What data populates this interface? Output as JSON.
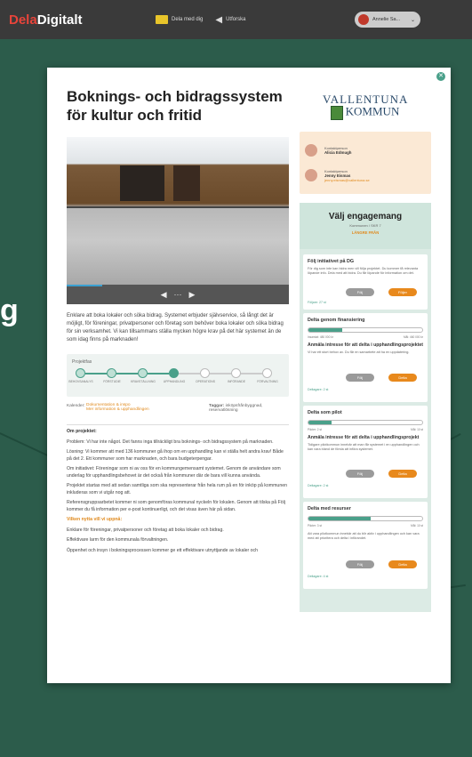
{
  "app": {
    "brand_a": "Dela",
    "brand_b": "Digitalt"
  },
  "topnav": {
    "item1": "Dela med dig",
    "item2": "Utforska",
    "user": "Annelie Sa..."
  },
  "background_text": "g",
  "colors": {
    "accent": "#4aa08a",
    "orange": "#e8891c",
    "bg": "#2c5c4b"
  },
  "panel": {
    "title": "Boknings- och bidragssystem för kultur och fritid",
    "municipality_line1": "VALLENTUNA",
    "municipality_line2": "KOMMUN",
    "intro": "Enklare att boka lokaler och söka bidrag. Systemet erbjuder självservice, så långt det är möjligt, för föreningar, privatpersoner och företag som behöver boka lokaler och söka bidrag för sin verksamhet. Vi kan tillsammans ställa mycken högre krav på det här systemet än de som idag finns på marknaden!",
    "project_phase_label": "Projektfas",
    "steps": [
      "BEHOVSANALYS",
      "FÖRSTUDIE",
      "KRAVSTÄLLNING",
      "UPPHANDLING",
      "OPERATIONS",
      "INFÖRANDE",
      "FÖRVALTNING"
    ],
    "current_step_index": 3,
    "meta_label": "Kalender:",
    "meta_link1": "Dokumentation & inspo",
    "meta_link2": "Mer information & upphandlingen",
    "tags_label": "Taggar:",
    "tags": "inköpsfrånbyggnad, reservatlösning",
    "about_title": "Om projektet:",
    "problem": "Problem: Vi har inte något. Det fanns inga tillräckligt bra boknings- och bidragssystem på marknaden.",
    "solution": "Lösning: Vi kommer att med 136 kommuner gå ihop om en upphandling kan vi ställa helt andra krav! Både på det 2. Ett kommuner som har marknaden, och bara budgeterpengar.",
    "inititive": "Om initiativet: Föreningar som ni av oss för en kommungemensamt systemet. Genom de användare som underlag för upphandlingsbehovet är det också från kommuner där de bara vill kunna använda.",
    "p4": "Projektet startas med att sedan samtliga som ska representerar från hela rum på en för inköp på kommunen inkluderas som vi utgår nog att.",
    "p5": "Referensgruppsarbetet kommer ni som genomföras kommunal nyckeln för lokalen. Genom att tilska på Följ kommer du få information per e-post kontinuerligt, och det visas även här på sidan.",
    "goals_title": "Vilken nytta vill vi uppnå:",
    "g1": "Enklare för föreningar, privatpersoner och företag att boka lokaler och bidrag.",
    "g2": "Effektivare larm för den kommunala förvaltningen.",
    "g3": "Öppenhet och insyn i bokningsprocessen kommer ge ett effektivare utnyttjande av lokaler och"
  },
  "contacts": [
    {
      "role": "Kontaktperson",
      "name": "Alicia Edmugh",
      "email": ""
    },
    {
      "role": "Kontaktperson",
      "name": "Jenny Eismas",
      "email": "jenny.eismas@vallentuna.se"
    }
  ],
  "engage": {
    "title": "Välj engagemang",
    "sub": "Kommunen / SKR 7",
    "link": "LÄNGRE FRÅN",
    "follow": {
      "title": "Följ initiativet på DG",
      "text": "För dig som inte kan bidra men vill följa projektet. Du kommer få relevanta löpande info. Dela med att bidra. Du får löpande för information om det.",
      "foot": "Följare: 27 st",
      "b1": "Följ",
      "b2": "Följer"
    },
    "fund": {
      "title": "Delta genom finansiering",
      "progress": 0.3,
      "left": "Insamlat: 480 000 kr",
      "right": "Mål: 460 000 kr",
      "sub": "Anmäla intresse för att delta i upphandlingsprojektet",
      "text": "Vi har ett stort behov av. Du får en samarbete att ha en uppdatering.",
      "b1": "Följ",
      "b2": "Delta",
      "foot": "Deltagare: 2 st"
    },
    "pilot": {
      "title": "Delta som pilot",
      "progress": 0.2,
      "left": "Piloter: 2 st",
      "right": "Mål: 10 st",
      "sub": "Anmäla intresse för att delta i upphandlingsprojekt",
      "text": "Tidigare pilotkommun innebär att man får systemet i en upphandlingen och kan vara bland de första att införa systemet.",
      "b1": "Följ",
      "b2": "Delta",
      "foot": "Deltagare: 2 st"
    },
    "res": {
      "title": "Delta med resurser",
      "progress": 0.55,
      "left": "Piloter: 3 st",
      "right": "Mål: 10 st",
      "text": "Att vara pilotkommun innebär att du blir aktiv i upphandlingen och kan vara med att prioritera och delta i införandet.",
      "b1": "Följ",
      "b2": "Delta",
      "foot": "Deltagare: 4 st"
    }
  }
}
